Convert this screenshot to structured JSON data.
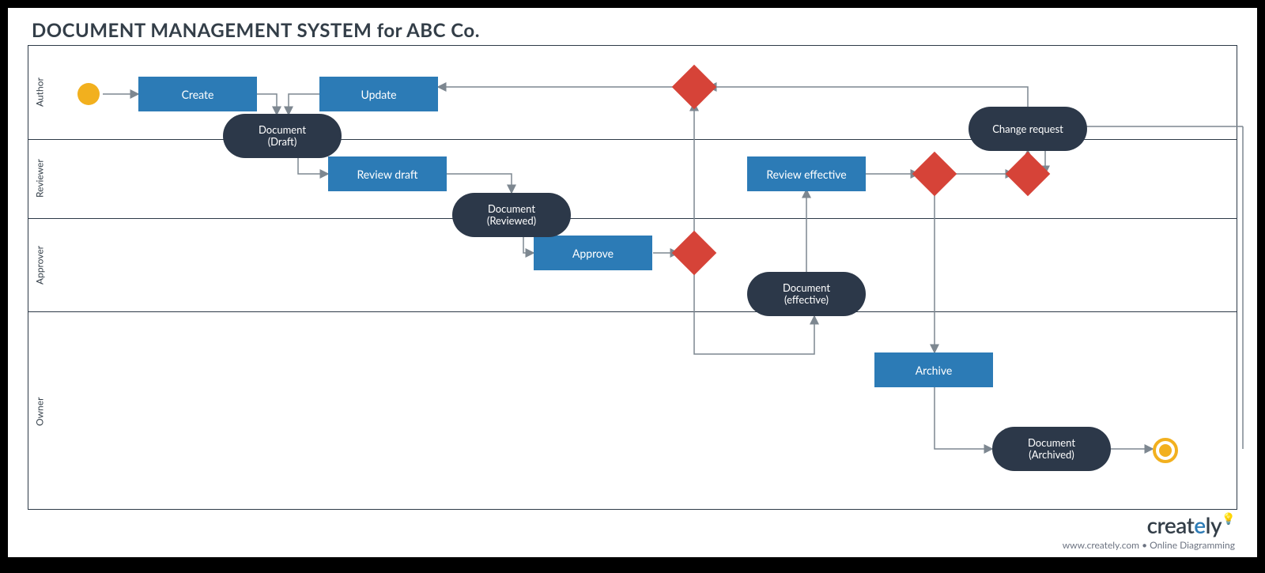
{
  "title": "DOCUMENT MANAGEMENT SYSTEM for ABC Co.",
  "lanes": {
    "author": "Author",
    "reviewer": "Reviewer",
    "approver": "Approver",
    "owner": "Owner"
  },
  "activities": {
    "create": "Create",
    "update": "Update",
    "review_draft": "Review draft",
    "approve": "Approve",
    "review_effective": "Review effective",
    "change_request": "Change request",
    "archive": "Archive"
  },
  "objects": {
    "draft": {
      "line1": "Document",
      "line2": "(Draft)"
    },
    "reviewed": {
      "line1": "Document",
      "line2": "(Reviewed)"
    },
    "effective": {
      "line1": "Document",
      "line2": "(effective)"
    },
    "archived": {
      "line1": "Document",
      "line2": "(Archived)"
    }
  },
  "colors": {
    "activity": "#2c7bb6",
    "object": "#2c3849",
    "decision": "#d64338",
    "start": "#f2b01e"
  },
  "diagram_type": "UML Activity / Swimlane",
  "flow": [
    "start -> Create",
    "Create -> Document(Draft)",
    "Update -> Document(Draft)",
    "Document(Draft) -> Review draft",
    "Review draft -> Document(Reviewed)",
    "Document(Reviewed) -> Approve",
    "Approve -> decision(Approver)",
    "decision(Approver) -> Document(effective)",
    "decision(Approver) -> decision(Author-top)  [reject path up to Update]",
    "Document(effective) -> Review effective",
    "Review effective -> decision(Reviewer-A)",
    "decision(Reviewer-A) -> Archive",
    "decision(Reviewer-A) -> decision(Reviewer-B)",
    "decision(Reviewer-B) -> Change request",
    "Change request -> decision(Author-top) -> Update",
    "Archive -> Document(Archived)",
    "Document(Archived) -> end"
  ],
  "brand": {
    "name": "creately",
    "tagline": "www.creately.com • Online Diagramming"
  }
}
